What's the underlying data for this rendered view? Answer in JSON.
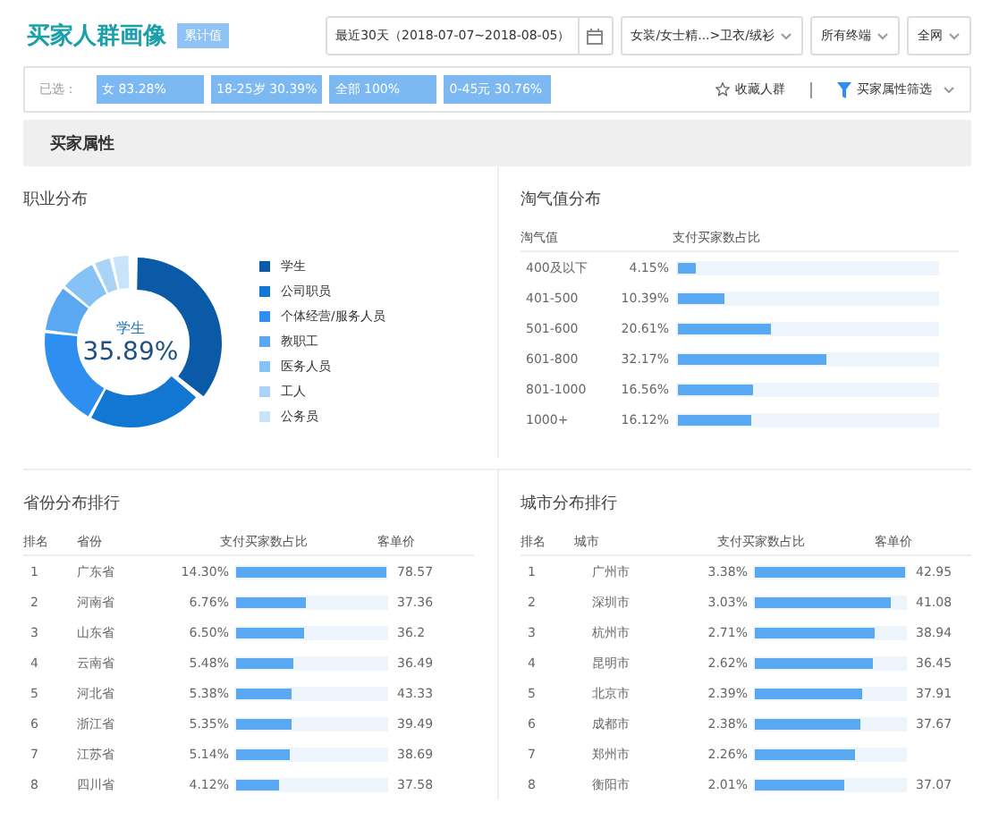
{
  "header": {
    "title": "买家人群画像",
    "badge": "累计值",
    "date_range": "最近30天（2018-07-07~2018-08-05）",
    "category": "女装/女士精...>卫衣/绒衫",
    "terminal": "所有终端",
    "scope": "全网"
  },
  "filter_bar": {
    "label": "已选：",
    "chips": [
      "女 83.28%",
      "18-25岁 30.39%",
      "全部 100%",
      "0-45元 30.76%"
    ],
    "favorite": "收藏人群",
    "attr_filter": "买家属性筛选"
  },
  "section_title": "买家属性",
  "occupation": {
    "title": "职业分布",
    "center_label": "学生",
    "center_value": "35.89%",
    "legend": [
      {
        "label": "学生",
        "color": "#0b5aa8"
      },
      {
        "label": "公司职员",
        "color": "#1276d3"
      },
      {
        "label": "个体经营/服务人员",
        "color": "#2f8ff0"
      },
      {
        "label": "教职工",
        "color": "#5aa8f2"
      },
      {
        "label": "医务人员",
        "color": "#86c2f6"
      },
      {
        "label": "工人",
        "color": "#a9d4f8"
      },
      {
        "label": "公务员",
        "color": "#c8e4fb"
      }
    ]
  },
  "taoqi": {
    "title": "淘气值分布",
    "columns": [
      "淘气值",
      "支付买家数占比"
    ],
    "rows": [
      {
        "range": "400及以下",
        "share": "4.15%",
        "level": 0.07
      },
      {
        "range": "401-500",
        "share": "10.39%",
        "level": 0.18
      },
      {
        "range": "501-600",
        "share": "20.61%",
        "level": 0.36
      },
      {
        "range": "601-800",
        "share": "32.17%",
        "level": 0.57
      },
      {
        "range": "801-1000",
        "share": "16.56%",
        "level": 0.29
      },
      {
        "range": "1000+",
        "share": "16.12%",
        "level": 0.28
      }
    ]
  },
  "province": {
    "title": "省份分布排行",
    "columns": [
      "排名",
      "省份",
      "支付买家数占比",
      "客单价"
    ],
    "rows": [
      {
        "rank": "1",
        "name": "广东省",
        "share": "14.30%",
        "level": 1,
        "price": "78.57"
      },
      {
        "rank": "2",
        "name": "河南省",
        "share": "6.76%",
        "level": 0.47,
        "price": "37.36"
      },
      {
        "rank": "3",
        "name": "山东省",
        "share": "6.50%",
        "level": 0.45,
        "price": "36.2"
      },
      {
        "rank": "4",
        "name": "云南省",
        "share": "5.48%",
        "level": 0.38,
        "price": "36.49"
      },
      {
        "rank": "5",
        "name": "河北省",
        "share": "5.38%",
        "level": 0.37,
        "price": "43.33"
      },
      {
        "rank": "6",
        "name": "浙江省",
        "share": "5.35%",
        "level": 0.37,
        "price": "39.49"
      },
      {
        "rank": "7",
        "name": "江苏省",
        "share": "5.14%",
        "level": 0.36,
        "price": "38.69"
      },
      {
        "rank": "8",
        "name": "四川省",
        "share": "4.12%",
        "level": 0.29,
        "price": "37.58"
      }
    ]
  },
  "city": {
    "title": "城市分布排行",
    "columns": [
      "排名",
      "城市",
      "支付买家数占比",
      "客单价"
    ],
    "rows": [
      {
        "rank": "1",
        "name": "广州市",
        "share": "3.38%",
        "level": 1,
        "price": "42.95"
      },
      {
        "rank": "2",
        "name": "深圳市",
        "share": "3.03%",
        "level": 0.9,
        "price": "41.08"
      },
      {
        "rank": "3",
        "name": "杭州市",
        "share": "2.71%",
        "level": 0.8,
        "price": "38.94"
      },
      {
        "rank": "4",
        "name": "昆明市",
        "share": "2.62%",
        "level": 0.78,
        "price": "36.45"
      },
      {
        "rank": "5",
        "name": "北京市",
        "share": "2.39%",
        "level": 0.71,
        "price": "37.91"
      },
      {
        "rank": "6",
        "name": "成都市",
        "share": "2.38%",
        "level": 0.7,
        "price": "37.67"
      },
      {
        "rank": "7",
        "name": "郑州市",
        "share": "2.26%",
        "level": 0.67
      },
      {
        "rank": "8",
        "name": "衡阳市",
        "share": "2.01%",
        "level": 0.59,
        "price": "37.07"
      }
    ]
  }
}
